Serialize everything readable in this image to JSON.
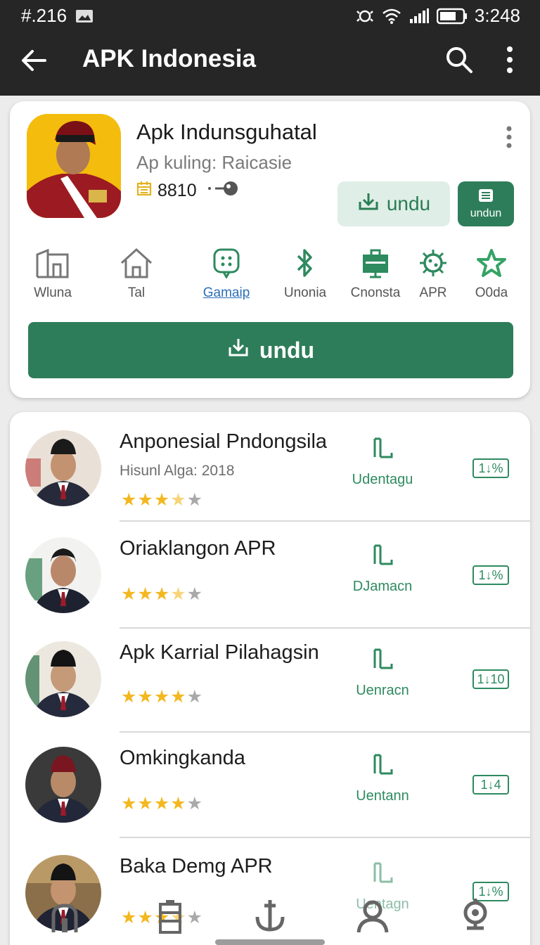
{
  "status_bar": {
    "left_text": "#.216",
    "time": "3:248",
    "icons": [
      "image-icon",
      "vibrate-icon",
      "wifi-icon",
      "signal-icon",
      "battery-icon"
    ]
  },
  "app_bar": {
    "title": "APK Indonesia",
    "icons": [
      "back-arrow-icon",
      "search-icon",
      "more-vertical-icon"
    ]
  },
  "featured": {
    "title": "Apk Indunsguhatal",
    "subtitle": "Ap kuling: Raicasie",
    "count": "8810",
    "light_button_label": "undu",
    "dark_button_label": "undun",
    "main_button_label": "undu",
    "categories": [
      {
        "label": "Wluna",
        "icon": "building-icon",
        "active": false
      },
      {
        "label": "Tal",
        "icon": "house-icon",
        "active": false
      },
      {
        "label": "Gamaip",
        "icon": "game-icon",
        "active": true
      },
      {
        "label": "Unonia",
        "icon": "bluetooth-icon",
        "active": false
      },
      {
        "label": "Cnonsta",
        "icon": "briefcase-icon",
        "active": false
      },
      {
        "label": "APR",
        "icon": "virus-icon",
        "active": false
      },
      {
        "label": "O0da",
        "icon": "star-icon",
        "active": false
      }
    ]
  },
  "apps": [
    {
      "name": "Anponesial Pndongsila",
      "subtitle": "Hisunl Alga: 2018",
      "rating": 3.5,
      "action_label": "Udentagu",
      "badge": "1↓%"
    },
    {
      "name": "Oriaklangon APR",
      "subtitle": "",
      "rating": 3.5,
      "action_label": "DJamacn",
      "badge": "1↓%"
    },
    {
      "name": "Apk Karrial Pilahagsin",
      "subtitle": "",
      "rating": 4,
      "action_label": "Uenracn",
      "badge": "1↓10"
    },
    {
      "name": "Omkingkanda",
      "subtitle": "",
      "rating": 4,
      "action_label": "Uentann",
      "badge": "1↓4"
    },
    {
      "name": "Baka Demg APR",
      "subtitle": "",
      "rating": 3.5,
      "action_label": "Uentagn",
      "badge": "1↓%"
    }
  ],
  "bottom_nav": [
    "home-icon",
    "clipboard-icon",
    "anchor-icon",
    "person-icon",
    "settings-icon"
  ],
  "colors": {
    "primary": "#2e7d5a",
    "accent_light": "#dfeee6",
    "link": "#2c6fb7",
    "star": "#f3b820",
    "appbar": "#262626"
  }
}
